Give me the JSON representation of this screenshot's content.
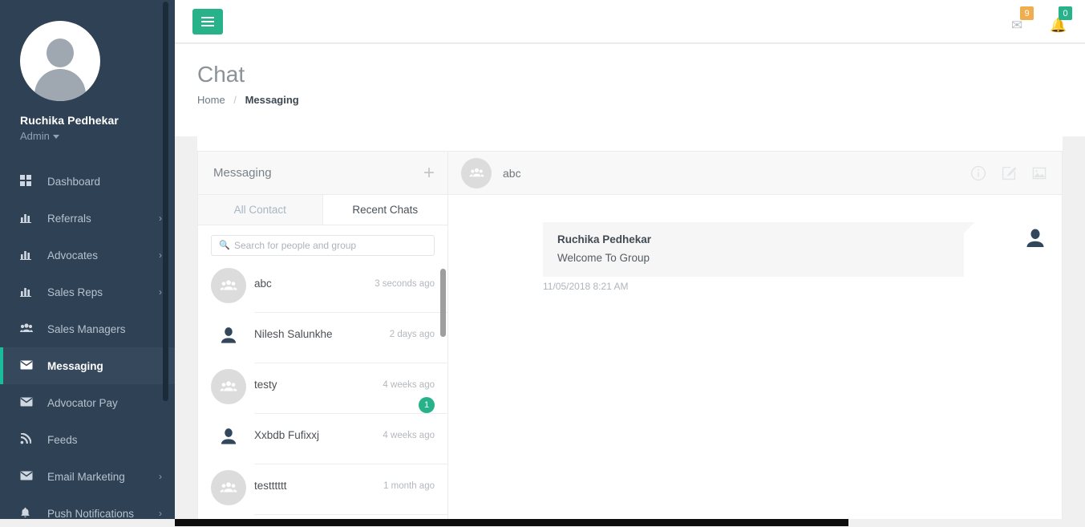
{
  "sidebar": {
    "profile": {
      "name": "Ruchika Pedhekar",
      "role": "Admin",
      "avatar_icon": "user-avatar-icon"
    },
    "items": [
      {
        "label": "Dashboard",
        "icon": "dashboard-grid-icon",
        "arrow": "",
        "active": false
      },
      {
        "label": "Referrals",
        "icon": "bar-chart-icon",
        "arrow": "›",
        "active": false
      },
      {
        "label": "Advocates",
        "icon": "bar-chart-icon",
        "arrow": "›",
        "active": false
      },
      {
        "label": "Sales Reps",
        "icon": "bar-chart-icon",
        "arrow": "›",
        "active": false
      },
      {
        "label": "Sales Managers",
        "icon": "users-group-icon",
        "arrow": "",
        "active": false
      },
      {
        "label": "Messaging",
        "icon": "envelope-icon",
        "arrow": "",
        "active": true
      },
      {
        "label": "Advocator Pay",
        "icon": "envelope-icon",
        "arrow": "",
        "active": false
      },
      {
        "label": "Feeds",
        "icon": "rss-feed-icon",
        "arrow": "",
        "active": false
      },
      {
        "label": "Email Marketing",
        "icon": "envelope-icon",
        "arrow": "›",
        "active": false
      },
      {
        "label": "Push Notifications",
        "icon": "bell-icon",
        "arrow": "›",
        "active": false
      }
    ]
  },
  "topbar": {
    "menu_toggle_label": "",
    "messages": {
      "icon": "envelope-icon",
      "count": "9",
      "color": "#f0ad4e"
    },
    "notifications": {
      "icon": "bell-icon",
      "count": "0",
      "color": "#27b28a"
    }
  },
  "page": {
    "title": "Chat",
    "breadcrumb": {
      "home": "Home",
      "separator": "/",
      "current": "Messaging"
    }
  },
  "messaging": {
    "panel_title": "Messaging",
    "add_icon": "plus-icon",
    "tabs": [
      {
        "label": "All Contact",
        "active": false
      },
      {
        "label": "Recent Chats",
        "active": true
      }
    ],
    "search": {
      "placeholder": "Search for people and group",
      "value": "",
      "icon": "search-icon"
    },
    "contacts": [
      {
        "name": "abc",
        "time": "3 seconds ago",
        "avatar": "group-avatar-icon",
        "badge": ""
      },
      {
        "name": "Nilesh Salunkhe",
        "time": "2 days ago",
        "avatar": "person-avatar-icon",
        "badge": ""
      },
      {
        "name": "testy",
        "time": "4 weeks ago",
        "avatar": "group-avatar-icon",
        "badge": "1"
      },
      {
        "name": "Xxbdb Fufixxj",
        "time": "4 weeks ago",
        "avatar": "person-avatar-icon",
        "badge": ""
      },
      {
        "name": "testttttt",
        "time": "1 month ago",
        "avatar": "group-avatar-icon",
        "badge": ""
      }
    ]
  },
  "chat": {
    "header": {
      "title": "abc",
      "avatar": "group-avatar-icon",
      "actions": [
        {
          "name": "info-icon"
        },
        {
          "name": "edit-pencil-icon"
        },
        {
          "name": "image-icon"
        }
      ]
    },
    "messages": [
      {
        "sender": "Ruchika Pedhekar",
        "text": "Welcome To Group",
        "timestamp": "11/05/2018 8:21 AM",
        "avatar": "person-avatar-icon"
      }
    ]
  },
  "colors": {
    "sidebar_bg": "#2f4154",
    "sidebar_active_bg": "#36495c",
    "accent_green": "#1abc9c",
    "button_green": "#27b28a",
    "badge_orange": "#f0ad4e",
    "page_bg": "#f0f0f0"
  }
}
